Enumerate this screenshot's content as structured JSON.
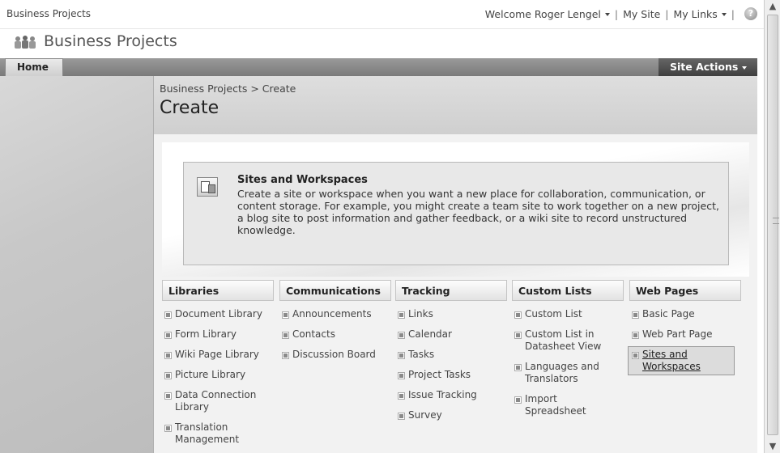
{
  "topbar": {
    "site_name": "Business Projects",
    "welcome": "Welcome Roger Lengel",
    "separator": "|",
    "my_site": "My Site",
    "my_links": "My Links",
    "help": "?"
  },
  "header": {
    "title": "Business Projects"
  },
  "nav": {
    "home_tab": "Home",
    "site_actions": "Site Actions"
  },
  "page": {
    "breadcrumb": "Business Projects > Create",
    "title": "Create"
  },
  "feature": {
    "title": "Sites and Workspaces",
    "description": "Create a site or workspace when you want a new place for collaboration, communication, or content storage. For example, you might create a team site to work together on a new project, a blog site to post information and gather feedback, or a wiki site to record unstructured knowledge."
  },
  "columns": [
    {
      "header": "Libraries",
      "items": [
        "Document Library",
        "Form Library",
        "Wiki Page Library",
        "Picture Library",
        "Data Connection Library",
        "Translation Management"
      ]
    },
    {
      "header": "Communications",
      "items": [
        "Announcements",
        "Contacts",
        "Discussion Board"
      ]
    },
    {
      "header": "Tracking",
      "items": [
        "Links",
        "Calendar",
        "Tasks",
        "Project Tasks",
        "Issue Tracking",
        "Survey"
      ]
    },
    {
      "header": "Custom Lists",
      "items": [
        "Custom List",
        "Custom List in Datasheet View",
        "Languages and Translators",
        "Import Spreadsheet"
      ]
    },
    {
      "header": "Web Pages",
      "items": [
        "Basic Page",
        "Web Part Page",
        "Sites and Workspaces"
      ]
    }
  ],
  "scrollbar": {
    "up": "▲",
    "down": "▼"
  }
}
